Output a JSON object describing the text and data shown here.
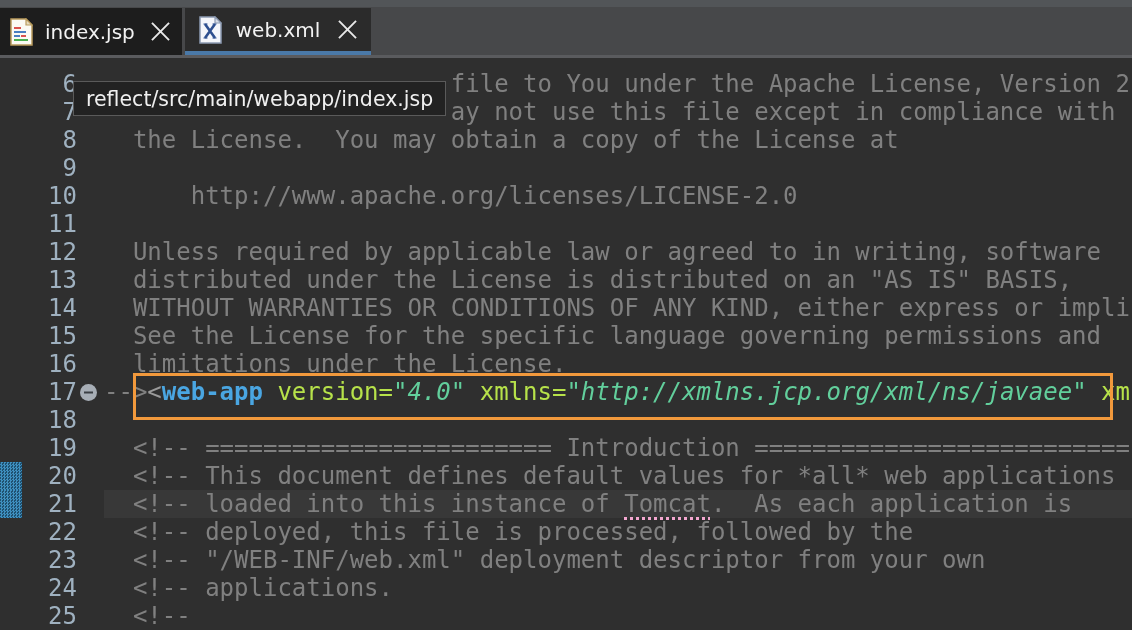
{
  "tabs": [
    {
      "label": "index.jsp",
      "kind": "jsp",
      "selected": false
    },
    {
      "label": "web.xml",
      "kind": "xml",
      "selected": true
    }
  ],
  "tooltip": {
    "text": "reflect/src/main/webapp/index.jsp"
  },
  "editor": {
    "lines": [
      {
        "number": "6",
        "kind": "covered",
        "text": "file to You under the Apache License, Version 2",
        "current": false,
        "changed": false,
        "boxed": false
      },
      {
        "number": "7",
        "kind": "covered",
        "text": "ay not use this file except in compliance with",
        "current": false,
        "changed": false,
        "boxed": false
      },
      {
        "number": "8",
        "kind": "comment",
        "text": "  the License.  You may obtain a copy of the License at",
        "current": false,
        "changed": false,
        "boxed": false
      },
      {
        "number": "9",
        "kind": "blank",
        "current": false,
        "changed": false,
        "boxed": false
      },
      {
        "number": "10",
        "kind": "comment",
        "text": "      http://www.apache.org/licenses/LICENSE-2.0",
        "current": false,
        "changed": false,
        "boxed": false
      },
      {
        "number": "11",
        "kind": "blank",
        "current": false,
        "changed": false,
        "boxed": false
      },
      {
        "number": "12",
        "kind": "comment",
        "text": "  Unless required by applicable law or agreed to in writing, software",
        "current": false,
        "changed": false,
        "boxed": false
      },
      {
        "number": "13",
        "kind": "comment",
        "text": "  distributed under the License is distributed on an \"AS IS\" BASIS,",
        "current": false,
        "changed": false,
        "boxed": false
      },
      {
        "number": "14",
        "kind": "comment",
        "text": "  WITHOUT WARRANTIES OR CONDITIONS OF ANY KIND, either express or impli",
        "current": false,
        "changed": false,
        "boxed": false
      },
      {
        "number": "15",
        "kind": "comment",
        "text": "  See the License for the specific language governing permissions and",
        "current": false,
        "changed": false,
        "boxed": false
      },
      {
        "number": "16",
        "kind": "comment",
        "text": "  limitations under the License.",
        "current": false,
        "changed": false,
        "boxed": false
      },
      {
        "number": "17",
        "kind": "markup",
        "expanded": true,
        "segments": [
          {
            "kind": "comment",
            "text": "-->"
          },
          {
            "kind": "bracket",
            "text": "<"
          },
          {
            "kind": "tag",
            "text": "web-app"
          },
          {
            "kind": "attr",
            "text": " version="
          },
          {
            "kind": "value",
            "text": "\"4.0\""
          },
          {
            "kind": "attr",
            "text": " xmlns="
          },
          {
            "kind": "value",
            "text": "\"http://xmlns.jcp.org/xml/ns/javaee\""
          },
          {
            "kind": "attr",
            "text": " xm"
          }
        ],
        "current": false,
        "changed": false,
        "boxed": true
      },
      {
        "number": "18",
        "kind": "blank",
        "current": false,
        "changed": false,
        "boxed": false
      },
      {
        "number": "19",
        "kind": "comment",
        "text": "  <!-- ======================== Introduction ==========================",
        "current": false,
        "changed": false,
        "boxed": false
      },
      {
        "number": "20",
        "kind": "comment",
        "text": "  <!-- This document defines default values for *all* web applications",
        "current": false,
        "changed": true,
        "boxed": false
      },
      {
        "number": "21",
        "kind": "comment",
        "segments": [
          {
            "kind": "comment",
            "text": "  <!-- loaded into this instance of "
          },
          {
            "kind": "misspelled",
            "text": "Tomcat"
          },
          {
            "kind": "comment",
            "text": ".  As each application is"
          }
        ],
        "current": true,
        "changed": true,
        "boxed": false
      },
      {
        "number": "22",
        "kind": "comment",
        "text": "  <!-- deployed, this file is processed, followed by the",
        "current": false,
        "changed": false,
        "boxed": false
      },
      {
        "number": "23",
        "kind": "comment",
        "text": "  <!-- \"/WEB-INF/web.xml\" deployment descriptor from your own",
        "current": false,
        "changed": false,
        "boxed": false
      },
      {
        "number": "24",
        "kind": "comment",
        "text": "  <!-- applications.",
        "current": false,
        "changed": false,
        "boxed": false
      },
      {
        "number": "25",
        "kind": "comment",
        "text": "  <!--",
        "current": false,
        "changed": false,
        "boxed": false
      }
    ]
  }
}
